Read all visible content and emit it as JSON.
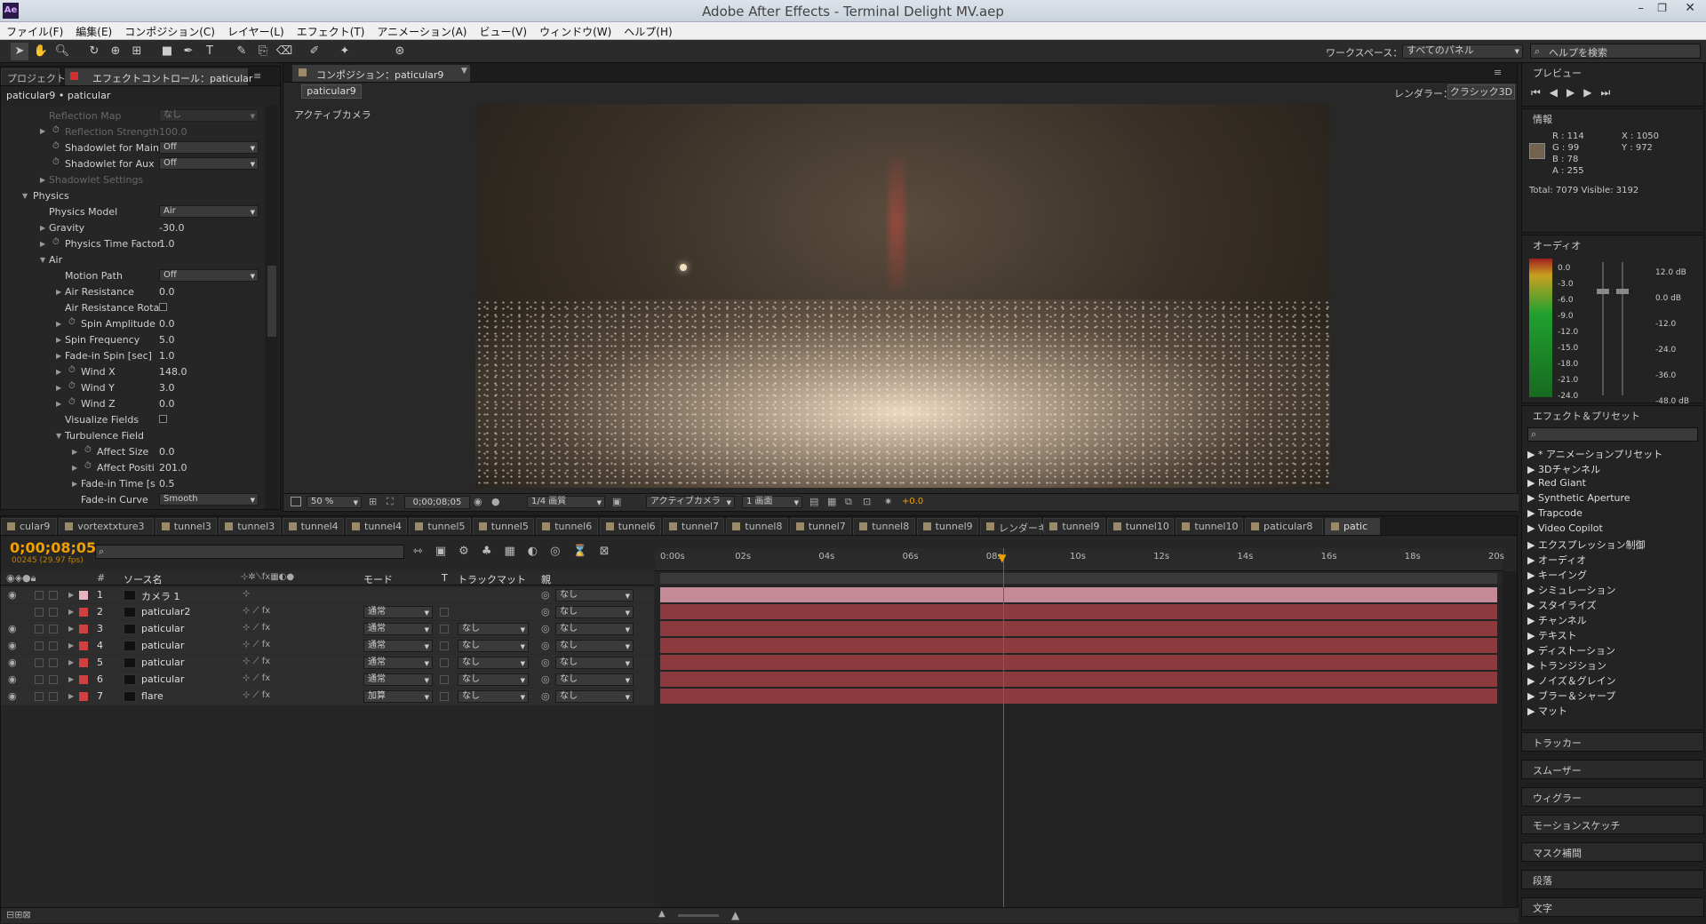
{
  "app": {
    "title": "Adobe After Effects - Terminal Delight MV.aep",
    "icon": "Ae"
  },
  "menu": [
    "ファイル(F)",
    "編集(E)",
    "コンポジション(C)",
    "レイヤー(L)",
    "エフェクト(T)",
    "アニメーション(A)",
    "ビュー(V)",
    "ウィンドウ(W)",
    "ヘルプ(H)"
  ],
  "toolbar": {
    "workspace_label": "ワークスペース：",
    "workspace_value": "すべてのパネル",
    "search_placeholder": "ヘルプを検索"
  },
  "effects_panel": {
    "tab_project": "プロジェクト",
    "tab_effects": "エフェクトコントロール：paticular",
    "breadcrumb": "paticular9 • paticular",
    "rows": [
      {
        "label": "Reflection Map",
        "value": "なし",
        "dim": true
      },
      {
        "label": "Reflection Strength",
        "value": "100.0",
        "dim": true
      },
      {
        "label": "Shadowlet for Main",
        "value": "Off"
      },
      {
        "label": "Shadowlet for Aux",
        "value": "Off"
      },
      {
        "label": "Shadowlet Settings",
        "value": "",
        "dim": true
      },
      {
        "label": "Physics",
        "value": ""
      },
      {
        "label": "Physics Model",
        "value": "Air"
      },
      {
        "label": "Gravity",
        "value": "-30.0"
      },
      {
        "label": "Physics Time Factor",
        "value": "1.0"
      },
      {
        "label": "Air",
        "value": ""
      },
      {
        "label": "Motion Path",
        "value": "Off"
      },
      {
        "label": "Air Resistance",
        "value": "0.0"
      },
      {
        "label": "Air Resistance Rota",
        "value": ""
      },
      {
        "label": "Spin Amplitude",
        "value": "0.0"
      },
      {
        "label": "Spin Frequency",
        "value": "5.0"
      },
      {
        "label": "Fade-in Spin [sec]",
        "value": "1.0"
      },
      {
        "label": "Wind X",
        "value": "148.0"
      },
      {
        "label": "Wind Y",
        "value": "3.0"
      },
      {
        "label": "Wind Z",
        "value": "0.0"
      },
      {
        "label": "Visualize Fields",
        "value": ""
      },
      {
        "label": "Turbulence Field",
        "value": ""
      },
      {
        "label": "Affect Size",
        "value": "0.0"
      },
      {
        "label": "Affect Positi",
        "value": "201.0"
      },
      {
        "label": "Fade-in Time [s",
        "value": "0.5"
      },
      {
        "label": "Fade-in Curve",
        "value": "Smooth"
      }
    ]
  },
  "comp": {
    "tab": "コンポジション：paticular9",
    "subtab": "paticular9",
    "renderer_label": "レンダラー：",
    "renderer_value": "クラシック3D",
    "camera_label": "アクティブカメラ",
    "zoom": "50 %",
    "timecode": "0;00;08;05",
    "resolution": "1/4 画質",
    "view": "アクティブカメラ",
    "views": "1 画面",
    "exposure": "+0.0"
  },
  "preview": {
    "title": "プレビュー"
  },
  "info": {
    "title": "情報",
    "r": "R : 114",
    "g": "G : 99",
    "b": "B : 78",
    "a": "A : 255",
    "x": "X : 1050",
    "y": "Y : 972",
    "total": "Total: 7079   Visible: 3192",
    "color": "#72634e"
  },
  "audio": {
    "title": "オーディオ",
    "left_scale": [
      "0.0",
      "-3.0",
      "-6.0",
      "-9.0",
      "-12.0",
      "-15.0",
      "-18.0",
      "-21.0",
      "-24.0"
    ],
    "right_scale": [
      "12.0 dB",
      "0.0 dB",
      "-12.0",
      "-24.0",
      "-36.0",
      "-48.0 dB"
    ]
  },
  "effects_presets": {
    "title": "エフェクト＆プリセット",
    "items": [
      "* アニメーションプリセット",
      "3Dチャンネル",
      "Red Giant",
      "Synthetic Aperture",
      "Trapcode",
      "Video Copilot",
      "エクスプレッション制御",
      "オーディオ",
      "キーイング",
      "シミュレーション",
      "スタイライズ",
      "チャンネル",
      "テキスト",
      "ディストーション",
      "トランジション",
      "ノイズ＆グレイン",
      "ブラー＆シャープ",
      "マット"
    ]
  },
  "small_panels": [
    "トラッカー",
    "スムーザー",
    "ウィグラー",
    "モーションスケッチ",
    "マスク補間",
    "段落",
    "文字"
  ],
  "timeline": {
    "tabs": [
      "cular9",
      "vortextxture3",
      "tunnel3",
      "tunnel3",
      "tunnel4",
      "tunnel4",
      "tunnel5",
      "tunnel5",
      "tunnel6",
      "tunnel6",
      "tunnel7",
      "tunnel8",
      "tunnel7",
      "tunnel8",
      "tunnel9",
      "レンダーキュー",
      "tunnel9",
      "tunnel10",
      "tunnel10",
      "paticular8",
      "patic"
    ],
    "timecode": "0;00;08;05",
    "fps": "00245 (29.97 fps)",
    "headers": {
      "source": "ソース名",
      "mode": "モード",
      "t": "T",
      "trackmatte": "トラックマット",
      "parent": "親"
    },
    "ruler": [
      "0:00s",
      "02s",
      "04s",
      "06s",
      "08s",
      "10s",
      "12s",
      "14s",
      "16s",
      "18s",
      "20s"
    ],
    "layers": [
      {
        "num": "1",
        "name": "カメラ 1",
        "mode": "",
        "matte": "",
        "parent": "なし",
        "color": "#e8b4c0",
        "camera": true
      },
      {
        "num": "2",
        "name": "paticular2",
        "mode": "通常",
        "matte": "",
        "parent": "なし",
        "color": "#d04040"
      },
      {
        "num": "3",
        "name": "paticular",
        "mode": "通常",
        "matte": "なし",
        "parent": "なし",
        "color": "#d04040"
      },
      {
        "num": "4",
        "name": "paticular",
        "mode": "通常",
        "matte": "なし",
        "parent": "なし",
        "color": "#d04040"
      },
      {
        "num": "5",
        "name": "paticular",
        "mode": "通常",
        "matte": "なし",
        "parent": "なし",
        "color": "#d04040"
      },
      {
        "num": "6",
        "name": "paticular",
        "mode": "通常",
        "matte": "なし",
        "parent": "なし",
        "color": "#d04040"
      },
      {
        "num": "7",
        "name": "flare",
        "mode": "加算",
        "matte": "なし",
        "parent": "なし",
        "color": "#d04040"
      }
    ],
    "playhead_fraction": 0.41
  }
}
